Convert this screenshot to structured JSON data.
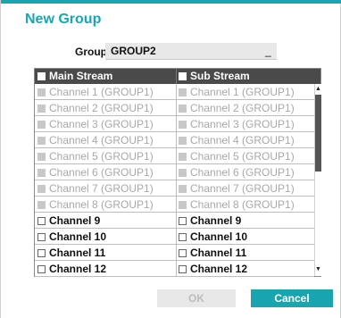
{
  "dialog": {
    "title": "New Group",
    "group_label": "Group",
    "group_value": "GROUP2",
    "cursor": "_"
  },
  "table": {
    "headers": {
      "main": "Main Stream",
      "sub": "Sub Stream"
    },
    "rows": [
      {
        "main": "Channel 1 (GROUP1)",
        "sub": "Channel 1 (GROUP1)",
        "state": "disabled"
      },
      {
        "main": "Channel 2 (GROUP1)",
        "sub": "Channel 2 (GROUP1)",
        "state": "disabled"
      },
      {
        "main": "Channel 3 (GROUP1)",
        "sub": "Channel 3 (GROUP1)",
        "state": "disabled"
      },
      {
        "main": "Channel 4 (GROUP1)",
        "sub": "Channel 4 (GROUP1)",
        "state": "disabled"
      },
      {
        "main": "Channel 5 (GROUP1)",
        "sub": "Channel 5 (GROUP1)",
        "state": "disabled"
      },
      {
        "main": "Channel 6 (GROUP1)",
        "sub": "Channel 6 (GROUP1)",
        "state": "disabled"
      },
      {
        "main": "Channel 7 (GROUP1)",
        "sub": "Channel 7 (GROUP1)",
        "state": "disabled"
      },
      {
        "main": "Channel 8 (GROUP1)",
        "sub": "Channel 8 (GROUP1)",
        "state": "disabled"
      },
      {
        "main": "Channel 9",
        "sub": "Channel 9",
        "state": "enabled"
      },
      {
        "main": "Channel 10",
        "sub": "Channel 10",
        "state": "enabled"
      },
      {
        "main": "Channel 11",
        "sub": "Channel 11",
        "state": "enabled"
      },
      {
        "main": "Channel 12",
        "sub": "Channel 12",
        "state": "enabled"
      }
    ]
  },
  "scrollbar": {
    "up_icon": "arrow-up-icon",
    "down_icon": "arrow-down-icon"
  },
  "buttons": {
    "ok": "OK",
    "cancel": "Cancel"
  },
  "colors": {
    "accent": "#18a5b0",
    "header_bg": "#4a4a4a",
    "disabled_text": "#a8a8a8"
  }
}
